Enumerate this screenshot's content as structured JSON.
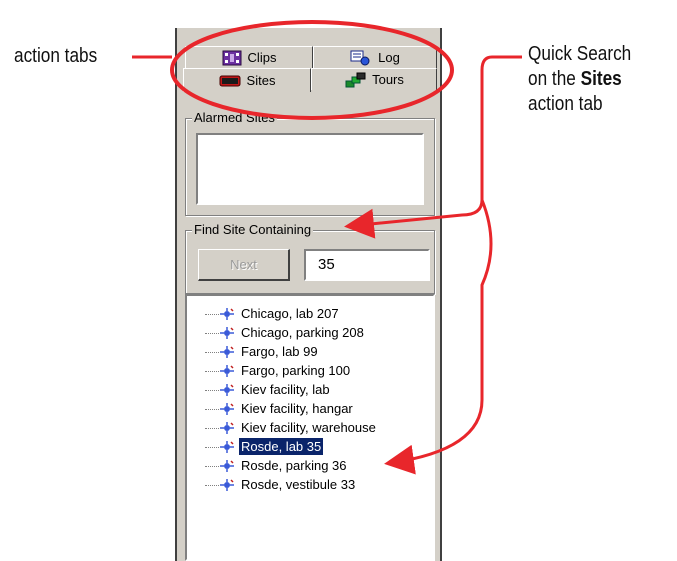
{
  "callouts": {
    "action_tabs": "action tabs",
    "quick_search_line1": "Quick Search",
    "quick_search_line2_prefix": "on the ",
    "quick_search_line2_bold": "Sites",
    "quick_search_line3": "action tab"
  },
  "tabs": {
    "clips": "Clips",
    "log": "Log",
    "sites": "Sites",
    "tours": "Tours"
  },
  "alarmed_sites": {
    "label": "Alarmed Sites"
  },
  "find_site": {
    "label": "Find Site Containing",
    "next_button": "Next",
    "search_value": "35"
  },
  "sites_tree": {
    "items": [
      {
        "label": "Chicago, lab 207",
        "selected": false
      },
      {
        "label": "Chicago, parking 208",
        "selected": false
      },
      {
        "label": "Fargo, lab 99",
        "selected": false
      },
      {
        "label": "Fargo, parking 100",
        "selected": false
      },
      {
        "label": "Kiev facility, lab",
        "selected": false
      },
      {
        "label": "Kiev facility, hangar",
        "selected": false
      },
      {
        "label": "Kiev facility, warehouse",
        "selected": false
      },
      {
        "label": "Rosde, lab 35",
        "selected": true
      },
      {
        "label": "Rosde, parking 36",
        "selected": false
      },
      {
        "label": "Rosde, vestibule 33",
        "selected": false
      }
    ]
  },
  "colors": {
    "annotation_red": "#e8262b",
    "selection_bg": "#0a246a",
    "window_bg": "#d4d0c8"
  },
  "icons": {
    "clips": "film-icon",
    "log": "log-icon",
    "sites": "sites-icon",
    "tours": "tours-icon",
    "site_item": "site-node-icon"
  }
}
